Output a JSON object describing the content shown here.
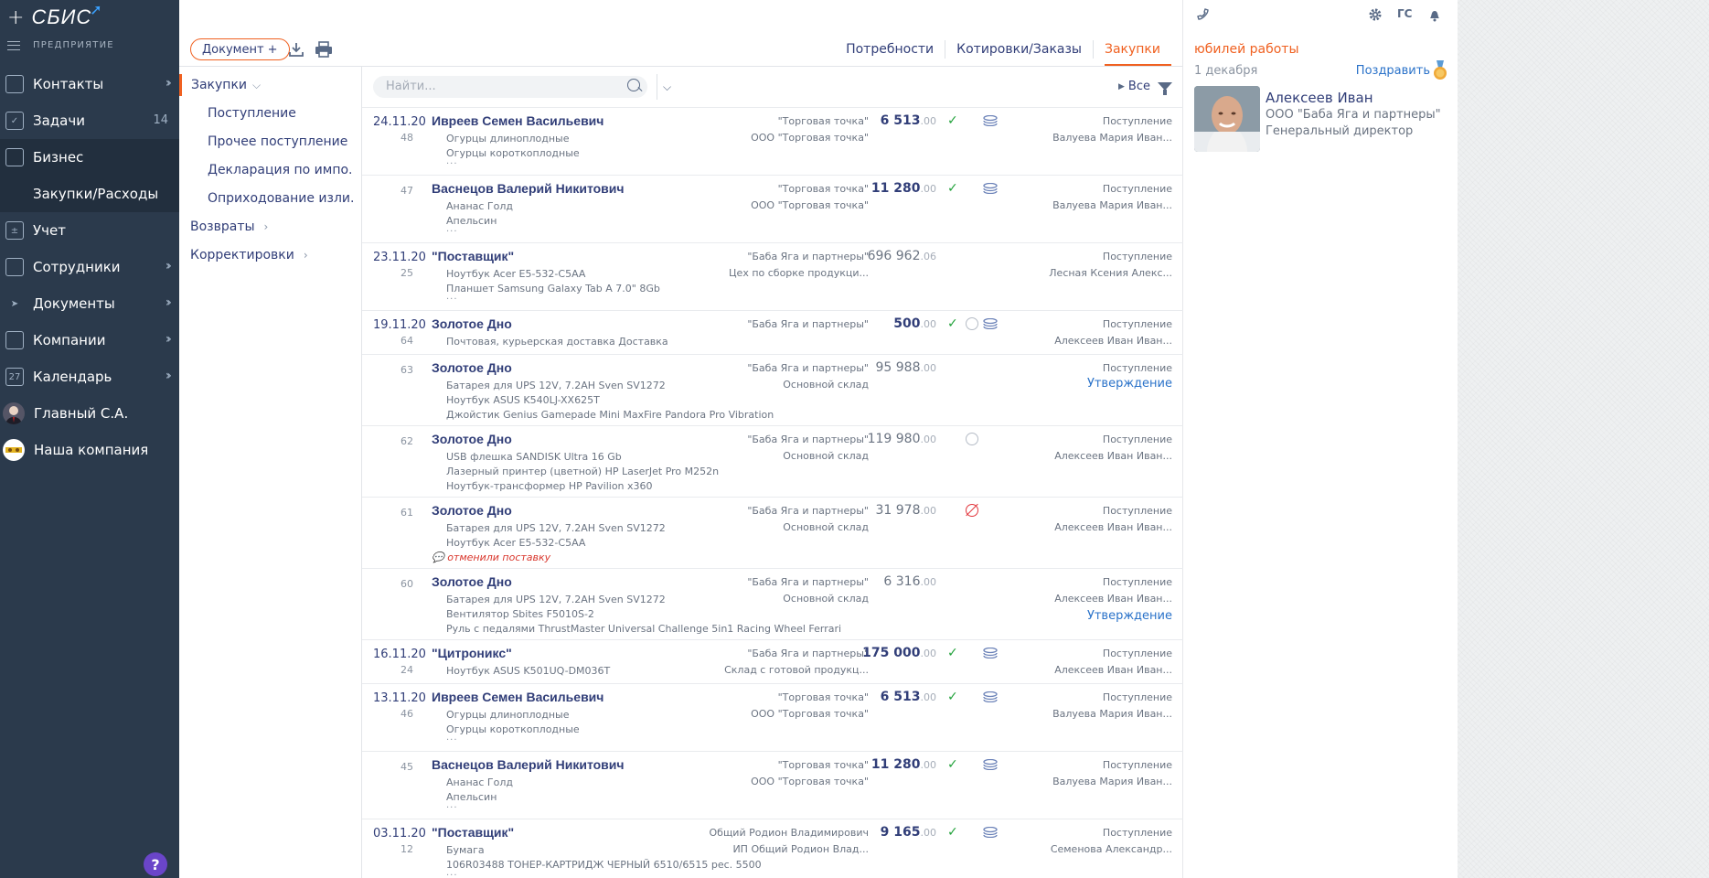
{
  "nav": {
    "brand": "СБИС",
    "section": "ПРЕДПРИЯТИЕ",
    "items": [
      {
        "label": "Контакты"
      },
      {
        "label": "Задачи",
        "count": "14"
      },
      {
        "label": "Бизнес"
      },
      {
        "label": "Закупки/Расходы"
      },
      {
        "label": "Учет"
      },
      {
        "label": "Сотрудники"
      },
      {
        "label": "Документы"
      },
      {
        "label": "Компании"
      },
      {
        "label": "Календарь",
        "icon_text": "27"
      },
      {
        "label": "Главный С.А."
      },
      {
        "label": "Наша компания"
      }
    ],
    "help": "?"
  },
  "toolbar": {
    "doc_button": "Документ +",
    "tabs": [
      "Потребности",
      "Котировки/Заказы",
      "Закупки"
    ]
  },
  "folders": {
    "root": "Закупки",
    "children": [
      "Поступление",
      "Прочее поступление",
      "Декларация по импо...",
      "Оприходование изли..."
    ],
    "others": [
      "Возвраты",
      "Корректировки"
    ]
  },
  "list": {
    "search_placeholder": "Найти...",
    "filter_label": "Все",
    "rows": [
      {
        "date": "24.11.20",
        "num": "48",
        "name": "Ивреев Семен Васильевич",
        "items": [
          "Огурцы длиноплодные",
          "Огурцы короткоплодные"
        ],
        "more": "...",
        "org": "\"Торговая точка\"",
        "org2": "ООО \"Торговая точка\"",
        "sum": "6 513",
        "kop": ".00",
        "status": "Поступление",
        "person": "Валуева Мария Иван..."
      },
      {
        "date": "",
        "num": "47",
        "name": "Васнецов Валерий Никитович",
        "items": [
          "Ананас Голд",
          "Апельсин"
        ],
        "more": "...",
        "org": "\"Торговая точка\"",
        "org2": "ООО \"Торговая точка\"",
        "sum": "11 280",
        "kop": ".00",
        "status": "Поступление",
        "person": "Валуева Мария Иван..."
      },
      {
        "date": "23.11.20",
        "num": "25",
        "name": "\"Поставщик\"",
        "items": [
          "Ноутбук Acer E5-532-C5AA",
          "Планшет Samsung Galaxy Tab A 7.0\" 8Gb"
        ],
        "more": "...",
        "org": "\"Баба Яга и партнеры\"",
        "org2": "Цех по сборке продукци...",
        "sum": "696 962",
        "kop": ".06",
        "status": "Поступление",
        "person": "Лесная Ксения Алекс..."
      },
      {
        "date": "19.11.20",
        "num": "64",
        "name": "Золотое Дно",
        "items": [
          "Почтовая, курьерская доставка Доставка"
        ],
        "more": "",
        "org": "\"Баба Яга и партнеры\"",
        "org2": "",
        "sum": "500",
        "kop": ".00",
        "status": "Поступление",
        "person": "Алексеев Иван Иван..."
      },
      {
        "date": "",
        "num": "63",
        "name": "Золотое Дно",
        "items": [
          "Батарея для UPS 12V, 7.2AH Sven SV1272",
          "Ноутбук ASUS K540LJ-XX625T",
          "Джойстик Genius Gamepade Mini MaxFire Pandora Pro Vibration"
        ],
        "more": "",
        "org": "\"Баба Яга и партнеры\"",
        "org2": "Основной склад",
        "sum": "95 988",
        "kop": ".00",
        "status": "Поступление",
        "link": "Утверждение"
      },
      {
        "date": "",
        "num": "62",
        "name": "Золотое Дно",
        "items": [
          "USB флешка SANDISK Ultra 16 Gb",
          "Лазерный принтер (цветной) HP LaserJet Pro M252n",
          "Ноутбук-трансформер HP Pavilion x360"
        ],
        "more": "",
        "org": "\"Баба Яга и партнеры\"",
        "org2": "Основной склад",
        "sum": "119 980",
        "kop": ".00",
        "status": "Поступление",
        "person": "Алексеев Иван Иван..."
      },
      {
        "date": "",
        "num": "61",
        "name": "Золотое Дно",
        "items": [
          "Батарея для UPS 12V, 7.2AH Sven SV1272",
          "Ноутбук Acer E5-532-C5AA"
        ],
        "more": "",
        "comment": "отменили поставку",
        "org": "\"Баба Яга и партнеры\"",
        "org2": "Основной склад",
        "sum": "31 978",
        "kop": ".00",
        "status": "Поступление",
        "person": "Алексеев Иван Иван..."
      },
      {
        "date": "",
        "num": "60",
        "name": "Золотое Дно",
        "items": [
          "Батарея для UPS 12V, 7.2AH Sven SV1272",
          "Вентилятор Sbites F5010S-2",
          "Руль с педалями ThrustMaster Universal Challenge 5in1 Racing Wheel Ferrari"
        ],
        "more": "",
        "org": "\"Баба Яга и партнеры\"",
        "org2": "Основной склад",
        "sum": "6 316",
        "kop": ".00",
        "status": "Поступление",
        "person": "Алексеев Иван Иван...",
        "link": "Утверждение"
      },
      {
        "date": "16.11.20",
        "num": "24",
        "name": "\"Цитроникс\"",
        "items": [
          "Ноутбук ASUS K501UQ-DM036T"
        ],
        "more": "",
        "org": "\"Баба Яга и партнеры\"",
        "org2": "Склад с готовой продукц...",
        "sum": "175 000",
        "kop": ".00",
        "status": "Поступление",
        "person": "Алексеев Иван Иван..."
      },
      {
        "date": "13.11.20",
        "num": "46",
        "name": "Ивреев Семен Васильевич",
        "items": [
          "Огурцы длиноплодные",
          "Огурцы короткоплодные"
        ],
        "more": "...",
        "org": "\"Торговая точка\"",
        "org2": "ООО \"Торговая точка\"",
        "sum": "6 513",
        "kop": ".00",
        "status": "Поступление",
        "person": "Валуева Мария Иван..."
      },
      {
        "date": "",
        "num": "45",
        "name": "Васнецов Валерий Никитович",
        "items": [
          "Ананас Голд",
          "Апельсин"
        ],
        "more": "...",
        "org": "\"Торговая точка\"",
        "org2": "ООО \"Торговая точка\"",
        "sum": "11 280",
        "kop": ".00",
        "status": "Поступление",
        "person": "Валуева Мария Иван..."
      },
      {
        "date": "03.11.20",
        "num": "12",
        "name": "\"Поставщик\"",
        "items": [
          "Бумага",
          "106R03488 ТОНЕР-КАРТРИДЖ ЧЕРНЫЙ 6510/6515 рес. 5500"
        ],
        "more": "...",
        "org": "Общий Родион Владимирович",
        "org2": "ИП Общий Родион Влад...",
        "sum": "9 165",
        "kop": ".00",
        "status": "Поступление",
        "person": "Семенова Александр..."
      }
    ]
  },
  "right_panel": {
    "user_initials": "ГС",
    "title": "юбилей работы",
    "date": "1 декабря",
    "congrat": "Поздравить",
    "person_name": "Алексеев Иван",
    "company": "ООО \"Баба Яга и партнеры\"",
    "position": "Генеральный директор"
  }
}
